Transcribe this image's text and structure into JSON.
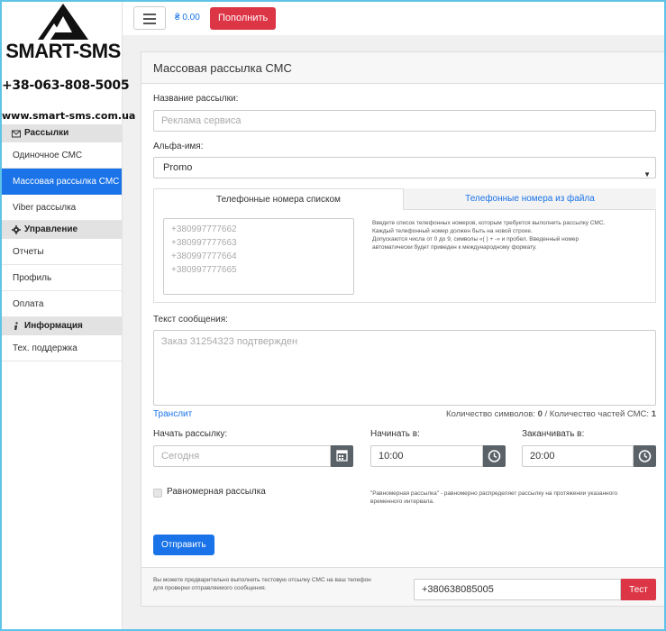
{
  "brand": {
    "logo_text": "SMART-SMS",
    "phone": "+38-063-808-5005",
    "site": "www.smart-sms.com.ua"
  },
  "sidebar": {
    "sections": [
      {
        "title": "Рассылки",
        "icon": "envelope-icon",
        "items": [
          {
            "label": "Одиночное СМС",
            "active": false
          },
          {
            "label": "Массовая рассылка СМС",
            "active": true
          },
          {
            "label": "Viber рассылка",
            "active": false
          }
        ]
      },
      {
        "title": "Управление",
        "icon": "gear-icon",
        "items": [
          {
            "label": "Отчеты",
            "active": false
          },
          {
            "label": "Профиль",
            "active": false
          },
          {
            "label": "Оплата",
            "active": false
          }
        ]
      },
      {
        "title": "Информация",
        "icon": "info-icon",
        "items": [
          {
            "label": "Тех. поддержка",
            "active": false
          }
        ]
      }
    ]
  },
  "topbar": {
    "balance": "₴ 0.00",
    "topup_label": "Пополнить"
  },
  "form": {
    "title": "Массовая рассылка СМС",
    "name_label": "Название рассылки:",
    "name_placeholder": "Реклама сервиса",
    "alpha_label": "Альфа-имя:",
    "alpha_value": "Promo",
    "tabs": [
      {
        "label": "Телефонные номера списком",
        "active": true
      },
      {
        "label": "Телефонные номера из файла",
        "active": false
      }
    ],
    "phones_placeholder": [
      "+380997777662",
      "+380997777663",
      "+380997777664",
      "+380997777665"
    ],
    "phones_hint": [
      "Введите список телефонных номеров, которым требуется выполнить рассылку СМС.",
      "Каждый телефонный номер должен быть на новой строке.",
      "Допускаются числа от 0 до 9, символы «( ) + -» и пробел. Введенный номер",
      "автоматически будет приведен к международному формату."
    ],
    "message_label": "Текст сообщения:",
    "message_placeholder": "Заказ 31254323 подтвержден",
    "translit": "Транслит",
    "chars_label": "Количество символов:",
    "chars_value": "0",
    "parts_label": "/ Количество частей СМС:",
    "parts_value": "1",
    "start_label": "Начать рассылку:",
    "start_placeholder": "Сегодня",
    "begin_label": "Начинать в:",
    "begin_value": "10:00",
    "end_label": "Заканчивать в:",
    "end_value": "20:00",
    "even_label": "Равномерная рассылка",
    "even_hint": [
      "\"Равномерная рассылка\" - равномерно распределяет рассылку на протяжении указанного",
      "временного интервала."
    ],
    "send_label": "Отправить",
    "test_hint": [
      "Вы можете предварительно выполнить тестовую отсылку СМС на ваш телефон",
      "для проверки отправляемого сообщения."
    ],
    "test_phone": "+380638085005",
    "test_label": "Тест"
  },
  "colors": {
    "primary": "#1a73e8",
    "danger": "#dc3545",
    "frame": "#5fc3e8"
  }
}
